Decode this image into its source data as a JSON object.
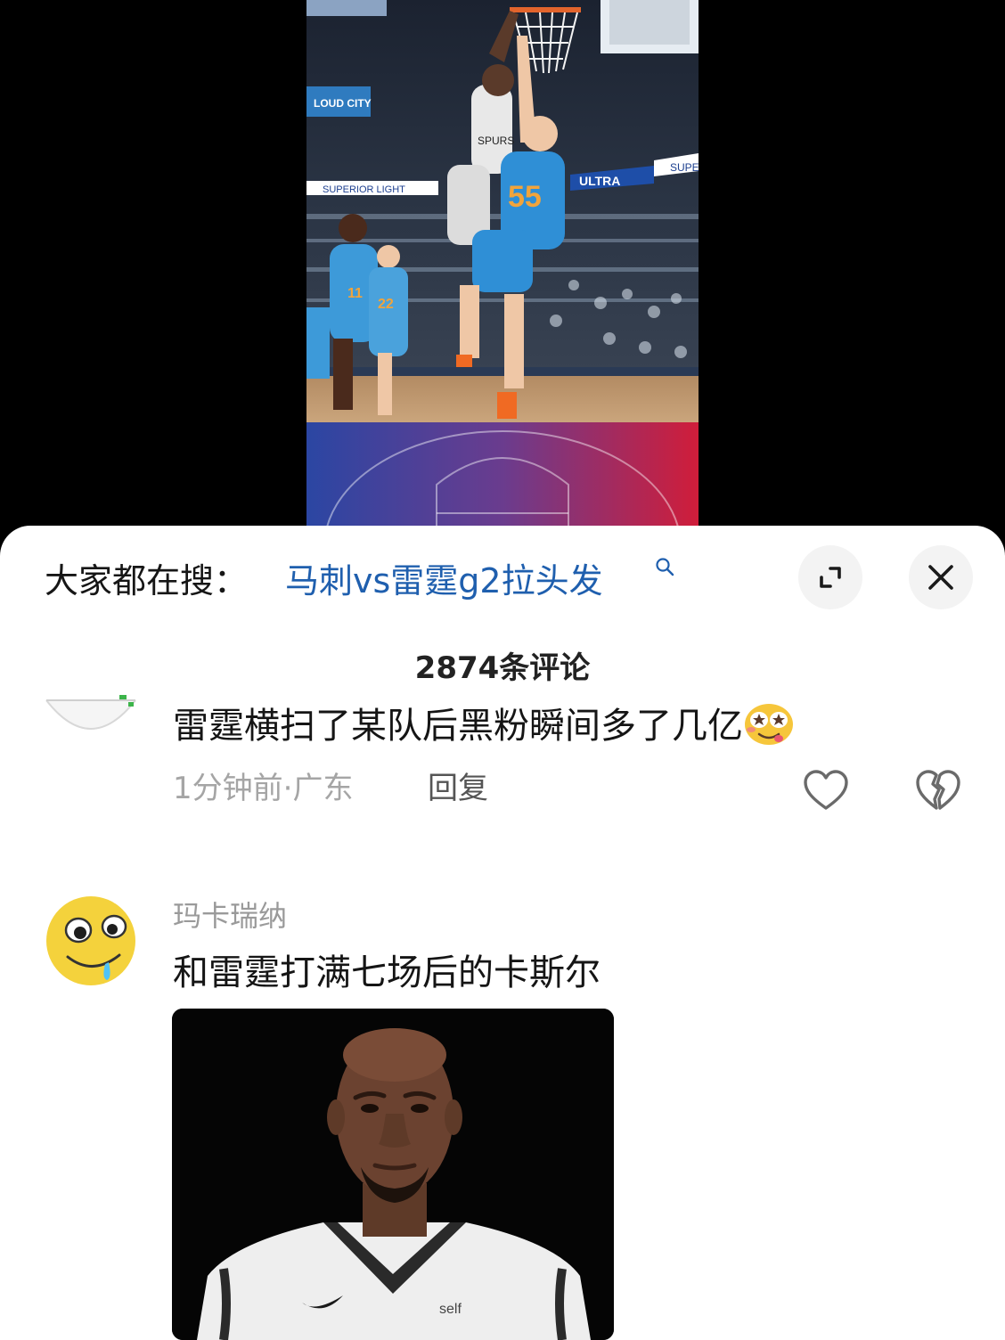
{
  "sheet": {
    "search_prefix": "大家都在搜：",
    "search_keyword": "马刺vs雷霆g2拉头发",
    "comment_count": "2874条评论"
  },
  "video": {
    "banner_texts": [
      "SUPERIOR LIGHT",
      "ULTRA",
      "SUPE"
    ],
    "jersey_number_main": "55",
    "jersey_number_left": "11",
    "jersey_number_mid": "22",
    "arena_sign": "LOUD CITY"
  },
  "comments": [
    {
      "text": "雷霆横扫了某队后黑粉瞬间多了几亿",
      "meta": "1分钟前·广东",
      "reply_label": "回复"
    },
    {
      "user": "玛卡瑞纳",
      "text": "和雷霆打满七场后的卡斯尔",
      "jersey_logo": "self"
    }
  ],
  "colors": {
    "keyword": "#1f5fae",
    "thunder_blue": "#2f8fd6",
    "banner_left": "#2b46a3",
    "banner_right": "#d01d3a"
  }
}
